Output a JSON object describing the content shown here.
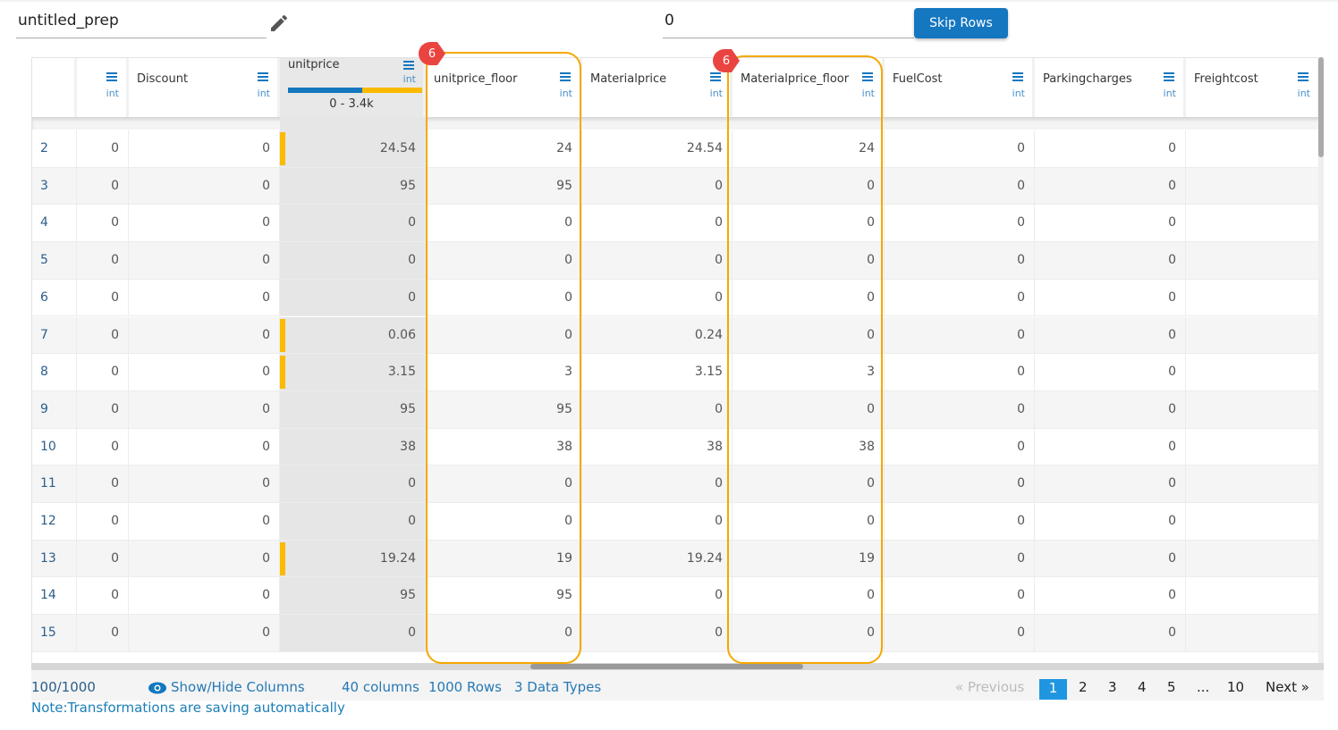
{
  "header": {
    "name": "untitled_prep",
    "skip_value": "0",
    "skip_button": "Skip Rows"
  },
  "columns": [
    {
      "name": "",
      "type": "int"
    },
    {
      "name": "Discount",
      "type": "int"
    },
    {
      "name": "unitprice",
      "type": "int",
      "range": "0 - 3.4k"
    },
    {
      "name": "unitprice_floor",
      "type": "int"
    },
    {
      "name": "Materialprice",
      "type": "int"
    },
    {
      "name": "Materialprice_floor",
      "type": "int"
    },
    {
      "name": "FuelCost",
      "type": "int"
    },
    {
      "name": "Parkingcharges",
      "type": "int"
    },
    {
      "name": "Freightcost",
      "type": "int"
    }
  ],
  "badges": [
    "6",
    "6"
  ],
  "rows": [
    [
      "2",
      "0",
      "0",
      "24.54",
      "24",
      "24.54",
      "24",
      "0",
      "0",
      ""
    ],
    [
      "3",
      "0",
      "0",
      "95",
      "95",
      "0",
      "0",
      "0",
      "0",
      ""
    ],
    [
      "4",
      "0",
      "0",
      "0",
      "0",
      "0",
      "0",
      "0",
      "0",
      ""
    ],
    [
      "5",
      "0",
      "0",
      "0",
      "0",
      "0",
      "0",
      "0",
      "0",
      ""
    ],
    [
      "6",
      "0",
      "0",
      "0",
      "0",
      "0",
      "0",
      "0",
      "0",
      ""
    ],
    [
      "7",
      "0",
      "0",
      "0.06",
      "0",
      "0.24",
      "0",
      "0",
      "0",
      ""
    ],
    [
      "8",
      "0",
      "0",
      "3.15",
      "3",
      "3.15",
      "3",
      "0",
      "0",
      ""
    ],
    [
      "9",
      "0",
      "0",
      "95",
      "95",
      "0",
      "0",
      "0",
      "0",
      ""
    ],
    [
      "10",
      "0",
      "0",
      "38",
      "38",
      "38",
      "38",
      "0",
      "0",
      ""
    ],
    [
      "11",
      "0",
      "0",
      "0",
      "0",
      "0",
      "0",
      "0",
      "0",
      ""
    ],
    [
      "12",
      "0",
      "0",
      "0",
      "0",
      "0",
      "0",
      "0",
      "0",
      ""
    ],
    [
      "13",
      "0",
      "0",
      "19.24",
      "19",
      "19.24",
      "19",
      "0",
      "0",
      ""
    ],
    [
      "14",
      "0",
      "0",
      "95",
      "95",
      "0",
      "0",
      "0",
      "0",
      ""
    ],
    [
      "15",
      "0",
      "0",
      "0",
      "0",
      "0",
      "0",
      "0",
      "0",
      ""
    ]
  ],
  "footer": {
    "count": "100/1000",
    "show_hide": "Show/Hide Columns",
    "columns": "40 columns",
    "rows": "1000 Rows",
    "types": "3 Data Types",
    "prev": "« Previous",
    "pages": [
      "1",
      "2",
      "3",
      "4",
      "5",
      "...",
      "10"
    ],
    "next": "Next »",
    "note": "Note:Transformations are saving automatically"
  },
  "colors": {
    "accent": "#1477c0",
    "highlight": "#f5a800",
    "badge": "#ea4440",
    "bar": "#fbb900"
  }
}
